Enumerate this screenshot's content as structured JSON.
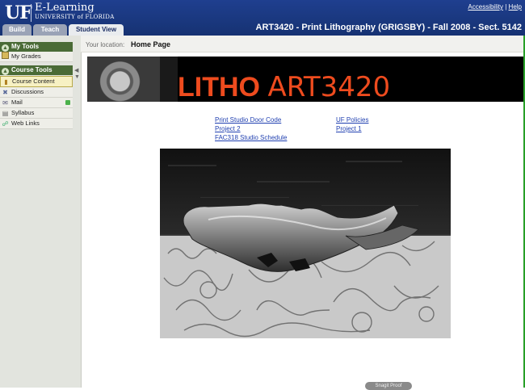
{
  "header": {
    "logo_uf": "UF",
    "logo_title": "E-Learning",
    "logo_subtitle": "UNIVERSITY of FLORIDA",
    "links": {
      "accessibility": "Accessibility",
      "separator": "|",
      "help": "Help"
    },
    "course_title": "ART3420 - Print Lithography (GRIGSBY) - Fall 2008 - Sect. 5142",
    "tabs": [
      {
        "label": "Build",
        "active": false
      },
      {
        "label": "Teach",
        "active": false
      },
      {
        "label": "Student View",
        "active": true
      }
    ]
  },
  "sidebar": {
    "my_tools": {
      "title": "My Tools",
      "items": [
        {
          "label": "My Grades",
          "icon": "grades-icon"
        }
      ]
    },
    "course_tools": {
      "title": "Course Tools",
      "items": [
        {
          "label": "Course Content",
          "icon": "folder-icon",
          "selected": true
        },
        {
          "label": "Discussions",
          "icon": "discussion-icon"
        },
        {
          "label": "Mail",
          "icon": "mail-icon",
          "has_badge": true
        },
        {
          "label": "Syllabus",
          "icon": "syllabus-icon"
        },
        {
          "label": "Web Links",
          "icon": "link-icon"
        }
      ]
    }
  },
  "breadcrumb": {
    "label": "Your location:",
    "value": "Home Page"
  },
  "banner": {
    "word1": "LITHO",
    "word2": "ART3420"
  },
  "links": {
    "col1": [
      "Print Studio Door Code",
      "Project 2",
      "FAC318 Studio Schedule"
    ],
    "col2": [
      "UF Policies",
      "Project 1"
    ]
  },
  "status": {
    "pill": "Snagit Proof"
  },
  "colors": {
    "header": "#1f3f8f",
    "accent_orange": "#ee4b1e",
    "panel_green": "#4a6b36",
    "link": "#1f3fb0"
  }
}
